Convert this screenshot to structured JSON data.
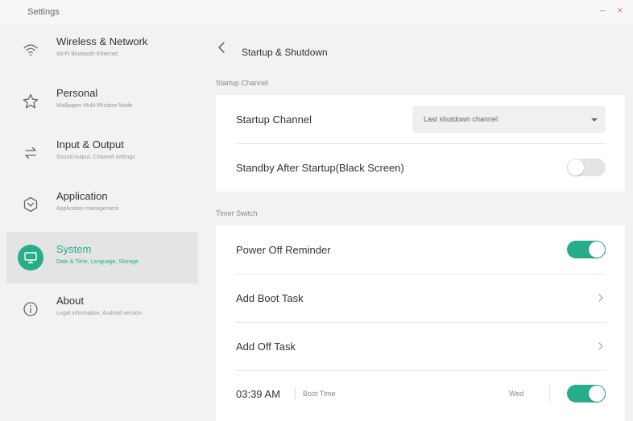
{
  "window": {
    "title": "Settings",
    "minimize_symbol": "–",
    "close_symbol": "×"
  },
  "sidebar": {
    "items": [
      {
        "title": "Wireless & Network",
        "subtitle": "Wi-Fi Bluetooth Ethernet",
        "icon": "wifi-icon",
        "active": false
      },
      {
        "title": "Personal",
        "subtitle": "Wallpaper Multi-Window Mode",
        "icon": "star-icon",
        "active": false
      },
      {
        "title": "Input & Output",
        "subtitle": "Sound output, Channel settings",
        "icon": "swap-arrows-icon",
        "active": false
      },
      {
        "title": "Application",
        "subtitle": "Application management",
        "icon": "app-hexagon-icon",
        "active": false
      },
      {
        "title": "System",
        "subtitle": "Date & Time, Language, Storage",
        "icon": "monitor-icon",
        "active": true
      },
      {
        "title": "About",
        "subtitle": "Legal information, Android version",
        "icon": "info-icon",
        "active": false
      }
    ]
  },
  "main": {
    "page_title": "Startup & Shutdown",
    "startup_section": {
      "label": "Startup Channel",
      "startup_channel_label": "Startup Channel",
      "startup_channel_value": "Last shutdown channel",
      "standby_label": "Standby After Startup(Black Screen)",
      "standby_enabled": false
    },
    "timer_section": {
      "label": "Timer Switch",
      "power_off_reminder_label": "Power Off Reminder",
      "power_off_reminder_enabled": true,
      "add_boot_task_label": "Add Boot Task",
      "add_off_task_label": "Add Off Task",
      "task": {
        "time": "03:39 AM",
        "type": "Boot Time",
        "day": "Wed",
        "enabled": true
      }
    }
  },
  "colors": {
    "accent": "#26ae8a",
    "background": "#f2f2f2",
    "card": "#ffffff"
  }
}
